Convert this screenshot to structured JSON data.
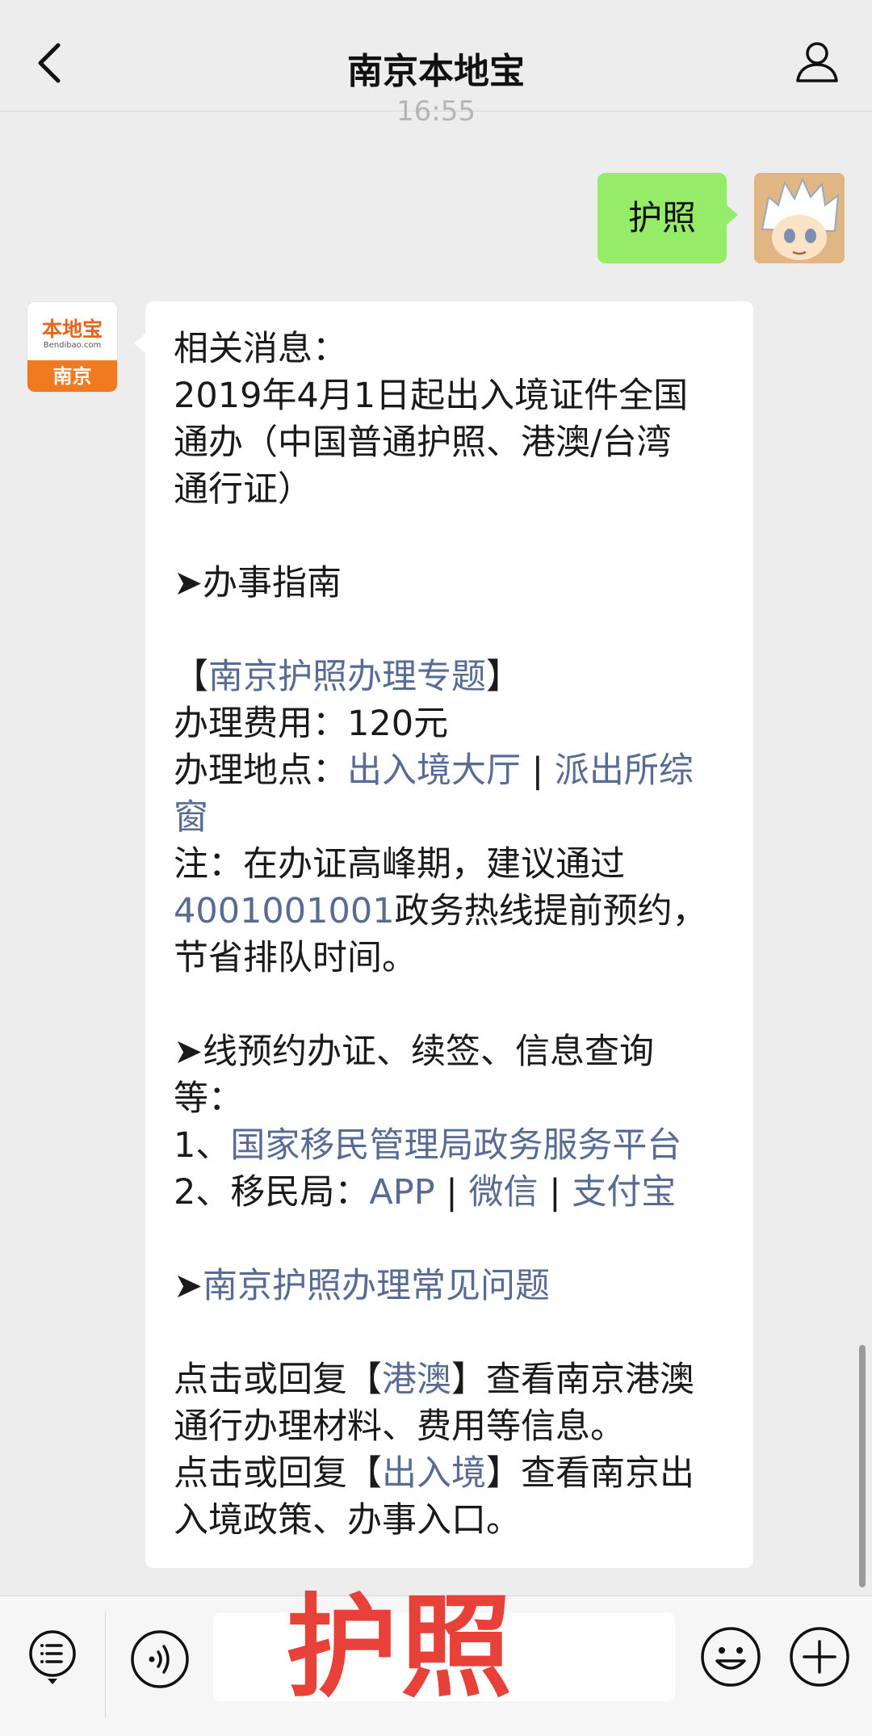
{
  "header": {
    "title": "南京本地宝"
  },
  "timestamp": "16:55",
  "user_message": {
    "text": "护照"
  },
  "bot_avatar": {
    "brand": "本地宝",
    "url": "Bendibao.com",
    "city": "南京"
  },
  "bot_message": {
    "line1": "相关消息：",
    "line2": "2019年4月1日起出入境证件全国",
    "line3": "通办（中国普通护照、港澳/台湾",
    "line4": "通行证）",
    "guide_heading": "➤办事指南",
    "topic_open": "【",
    "topic_link": "南京护照办理专题",
    "topic_close": "】",
    "fee": "办理费用：120元",
    "location_label": "办理地点：",
    "location_link1": "出入境大厅",
    "location_sep": " | ",
    "location_link2a": "派出所综",
    "location_link2b": "窗",
    "note_line1": "注：在办证高峰期，建议通过",
    "note_phone": "4001001001",
    "note_line2_rest": "政务热线提前预约，",
    "note_line3": "节省排队时间。",
    "online_heading1": "➤线预约办证、续签、信息查询",
    "online_heading2": "等：",
    "item1_prefix": "1、",
    "item1_link": "国家移民管理局政务服务平台",
    "item2_prefix": "2、移民局：",
    "item2_link1": "APP",
    "item2_sep1": " | ",
    "item2_link2": "微信",
    "item2_sep2": " | ",
    "item2_link3": "支付宝",
    "faq_arrow": "➤",
    "faq_link": "南京护照办理常见问题",
    "hk_prefix": "点击或回复【",
    "hk_link": "港澳",
    "hk_suffix": "】查看南京港澳",
    "hk_line2": "通行办理材料、费用等信息。",
    "exit_prefix": "点击或回复【",
    "exit_link": "出入境",
    "exit_suffix": "】查看南京出",
    "exit_line2": "入境政策、办事入口。"
  },
  "overlay": {
    "text": "护照"
  },
  "colors": {
    "link": "#576b95",
    "user_bubble": "#95ec69",
    "overlay": "#e8413a",
    "brand": "#f07a20"
  }
}
